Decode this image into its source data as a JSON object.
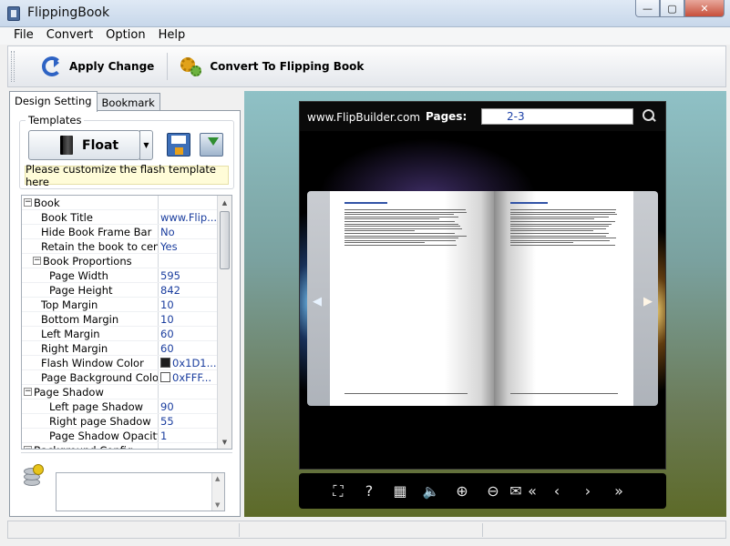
{
  "window": {
    "title": "FlippingBook",
    "controls": {
      "minimize": "—",
      "maximize": "▢",
      "close": "✕"
    }
  },
  "menu": [
    "File",
    "Convert",
    "Option",
    "Help"
  ],
  "toolbar": {
    "apply_label": "Apply Change",
    "convert_label": "Convert To Flipping Book"
  },
  "tabs": {
    "design": "Design Setting",
    "bookmark": "Bookmark"
  },
  "templates": {
    "legend": "Templates",
    "selected": "Float",
    "hint": "Please customize the flash template here"
  },
  "grid": {
    "rows": [
      {
        "name": "Book",
        "value": "",
        "type": "cat",
        "indent": 0,
        "toggle": "−"
      },
      {
        "name": "Book Title",
        "value": "www.Flip...",
        "indent": 1
      },
      {
        "name": "Hide Book Frame Bar",
        "value": "No",
        "indent": 1
      },
      {
        "name": "Retain the book to center",
        "value": "Yes",
        "indent": 1
      },
      {
        "name": "Book Proportions",
        "value": "",
        "type": "subcat",
        "indent": 1,
        "toggle": "−"
      },
      {
        "name": "Page Width",
        "value": "595",
        "indent": 2
      },
      {
        "name": "Page Height",
        "value": "842",
        "indent": 2
      },
      {
        "name": "Top Margin",
        "value": "10",
        "indent": 1
      },
      {
        "name": "Bottom Margin",
        "value": "10",
        "indent": 1
      },
      {
        "name": "Left Margin",
        "value": "60",
        "indent": 1
      },
      {
        "name": "Right Margin",
        "value": "60",
        "indent": 1
      },
      {
        "name": "Flash Window Color",
        "value": "0x1D1...",
        "indent": 1,
        "swatch": "#1d1d1d"
      },
      {
        "name": "Page Background Color",
        "value": "0xFFF...",
        "indent": 1,
        "swatch": "#ffffff"
      },
      {
        "name": "Page Shadow",
        "value": "",
        "type": "subcat",
        "indent": 0,
        "toggle": "−"
      },
      {
        "name": "Left page Shadow",
        "value": "90",
        "indent": 2
      },
      {
        "name": "Right page Shadow",
        "value": "55",
        "indent": 2
      },
      {
        "name": "Page Shadow Opacity",
        "value": "1",
        "indent": 2
      },
      {
        "name": "Background Config",
        "value": "",
        "type": "cat",
        "indent": 0,
        "toggle": "−"
      }
    ]
  },
  "preview": {
    "site": "www.FlipBuilder.com",
    "pages_label": "Pages:",
    "pages_value": "2-3",
    "prev_arrow": "◀",
    "next_arrow": "▶",
    "controls": [
      "⛶",
      "?",
      "▦",
      "🔈",
      "⊕",
      "⊖",
      "✉",
      "«",
      "‹",
      "›",
      "»"
    ]
  },
  "icons": {
    "app": "flippingbook-app-icon",
    "apply": "refresh-icon",
    "convert": "gears-icon",
    "book": "book-icon",
    "save": "save-icon",
    "load": "load-icon",
    "search": "magnify-icon",
    "database": "database-icon"
  }
}
